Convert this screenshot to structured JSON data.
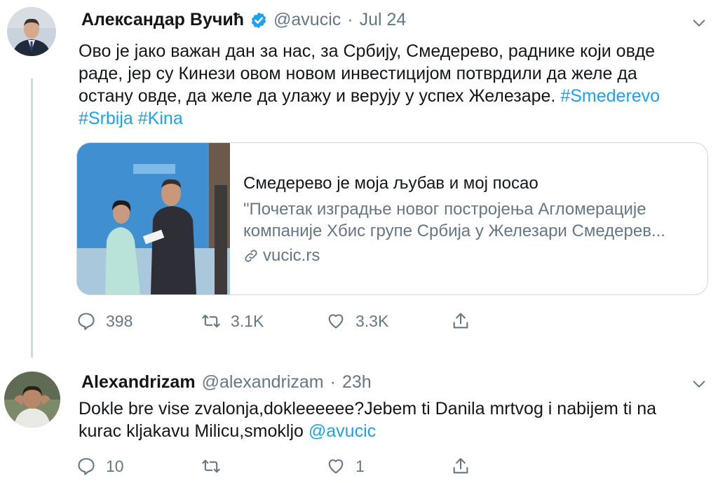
{
  "tweet1": {
    "author_name": "Александар Вучић",
    "handle": "@avucic",
    "separator": "·",
    "date": "Jul 24",
    "text_line1": "Ово је јако важан дан за нас, за Србију, Смедерево, раднике који овде",
    "text_line2": "раде, јер су Кинези овом новом инвестицијом потврдили да желе да",
    "text_line3": "остану овде, да желе да улажу и верују у успех Железаре.",
    "hashtag1": "#Smederevo",
    "hashtag2": "#Srbija",
    "hashtag3": "#Kina",
    "card": {
      "title": "Смедерево је моја љубав и мој посао",
      "description_line1": "\"Почетак изградње новог постројења Агломерације",
      "description_line2": "компаније Хбис групе Србија у Железари Смедерев...",
      "domain": "vucic.rs"
    },
    "actions": {
      "replies": "398",
      "retweets": "3.1K",
      "likes": "3.3K"
    }
  },
  "tweet2": {
    "author_name": "Alexandrizam",
    "handle": "@alexandrizam",
    "separator": "·",
    "date": "23h",
    "text_line1": "Dokle bre vise zvalonja,dokleeeeee?Jebem ti Danila mrtvog i nabijem ti na",
    "text_line2": "kurac kljakavu Milicu,smokljo",
    "mention": "@avucic",
    "actions": {
      "replies": "10",
      "retweets": "",
      "likes": "1"
    }
  },
  "colors": {
    "link": "#1da1f2",
    "muted": "#657786",
    "text": "#14171a",
    "verified": "#1da1f2"
  }
}
